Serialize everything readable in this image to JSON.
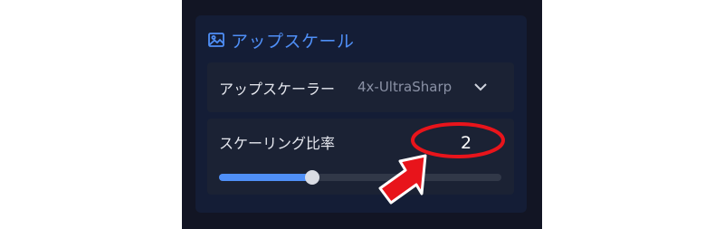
{
  "panel": {
    "title": "アップスケール",
    "icon": "image-icon"
  },
  "upscaler": {
    "label": "アップスケーラー",
    "selected": "4x-UltraSharp",
    "dropdown_icon": "chevron-down-icon"
  },
  "scale": {
    "label": "スケーリング比率",
    "value": "2",
    "slider_fraction": 0.33
  },
  "colors": {
    "accent": "#4f8ff7",
    "annotation": "#e8141b"
  }
}
